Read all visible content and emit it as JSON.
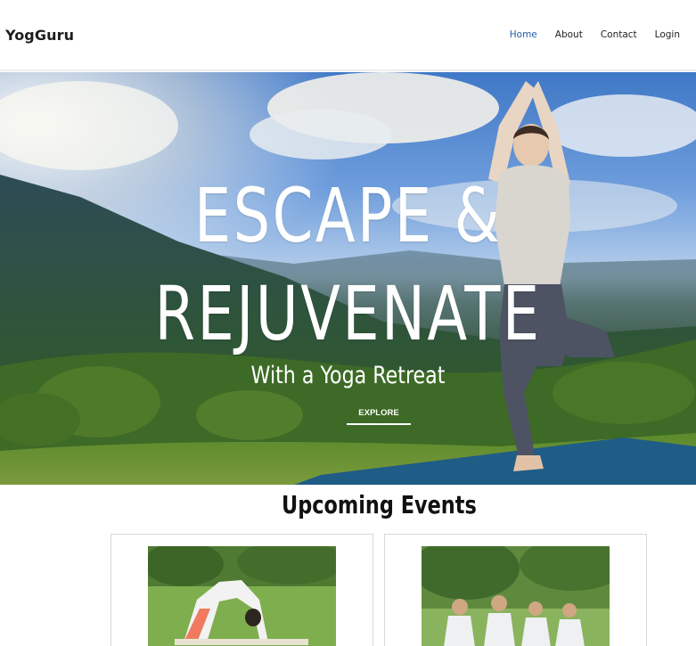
{
  "navbar": {
    "brand": "YogGuru",
    "links": [
      {
        "label": "Home",
        "active": true
      },
      {
        "label": "About",
        "active": false
      },
      {
        "label": "Contact",
        "active": false
      },
      {
        "label": "Login",
        "active": false
      }
    ],
    "active_color": "#1f5fa8"
  },
  "hero": {
    "title_line1": "ESCAPE &",
    "title_line2": "REJUVENATE",
    "subtitle": "With a Yoga Retreat",
    "cta_label": "EXPLORE"
  },
  "events": {
    "heading": "Upcoming Events",
    "cards": [
      {
        "image": "woman-backbend-in-park-photo"
      },
      {
        "image": "group-meditation-in-park-photo"
      }
    ]
  }
}
